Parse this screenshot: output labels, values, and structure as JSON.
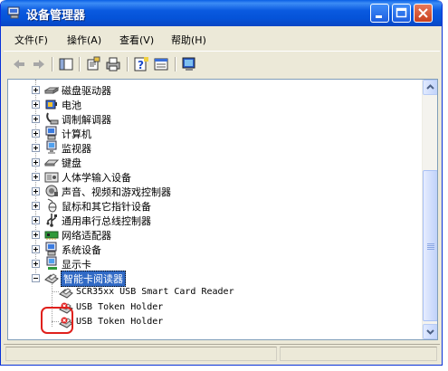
{
  "window": {
    "title": "设备管理器"
  },
  "menu": [
    {
      "label": "文件(F)"
    },
    {
      "label": "操作(A)"
    },
    {
      "label": "查看(V)"
    },
    {
      "label": "帮助(H)"
    }
  ],
  "toolbar": {
    "buttons": [
      "back-arrow-icon",
      "forward-arrow-icon",
      "console-tree-icon",
      "properties-icon",
      "print-icon",
      "help-icon",
      "view-icon",
      "scan-hardware-icon"
    ]
  },
  "tree": {
    "items": [
      {
        "label": "磁盘驱动器",
        "icon": "disk-drive-icon",
        "expanded": false
      },
      {
        "label": "电池",
        "icon": "battery-icon",
        "expanded": false
      },
      {
        "label": "调制解调器",
        "icon": "modem-icon",
        "expanded": false
      },
      {
        "label": "计算机",
        "icon": "computer-icon",
        "expanded": false
      },
      {
        "label": "监视器",
        "icon": "monitor-icon",
        "expanded": false
      },
      {
        "label": "键盘",
        "icon": "keyboard-icon",
        "expanded": false
      },
      {
        "label": "人体学输入设备",
        "icon": "hid-icon",
        "expanded": false
      },
      {
        "label": "声音、视频和游戏控制器",
        "icon": "sound-icon",
        "expanded": false
      },
      {
        "label": "鼠标和其它指针设备",
        "icon": "mouse-icon",
        "expanded": false
      },
      {
        "label": "通用串行总线控制器",
        "icon": "usb-icon",
        "expanded": false
      },
      {
        "label": "网络适配器",
        "icon": "network-adapter-icon",
        "expanded": false
      },
      {
        "label": "系统设备",
        "icon": "system-device-icon",
        "expanded": false
      },
      {
        "label": "显示卡",
        "icon": "display-adapter-icon",
        "expanded": false
      },
      {
        "label": "智能卡阅读器",
        "icon": "smart-card-reader-icon",
        "expanded": true,
        "selected": true
      }
    ],
    "children": [
      {
        "label": "SCR35xx USB Smart Card Reader",
        "icon": "card-reader-device-icon",
        "warning": false
      },
      {
        "label": "USB Token Holder",
        "icon": "token-warning-icon",
        "warning": true
      },
      {
        "label": "USB Token Holder",
        "icon": "token-warning-icon",
        "warning": true
      }
    ]
  },
  "colors": {
    "titlebar": "#0a5ae0",
    "selection": "#316ac5",
    "highlight_ring": "#e0201c"
  }
}
